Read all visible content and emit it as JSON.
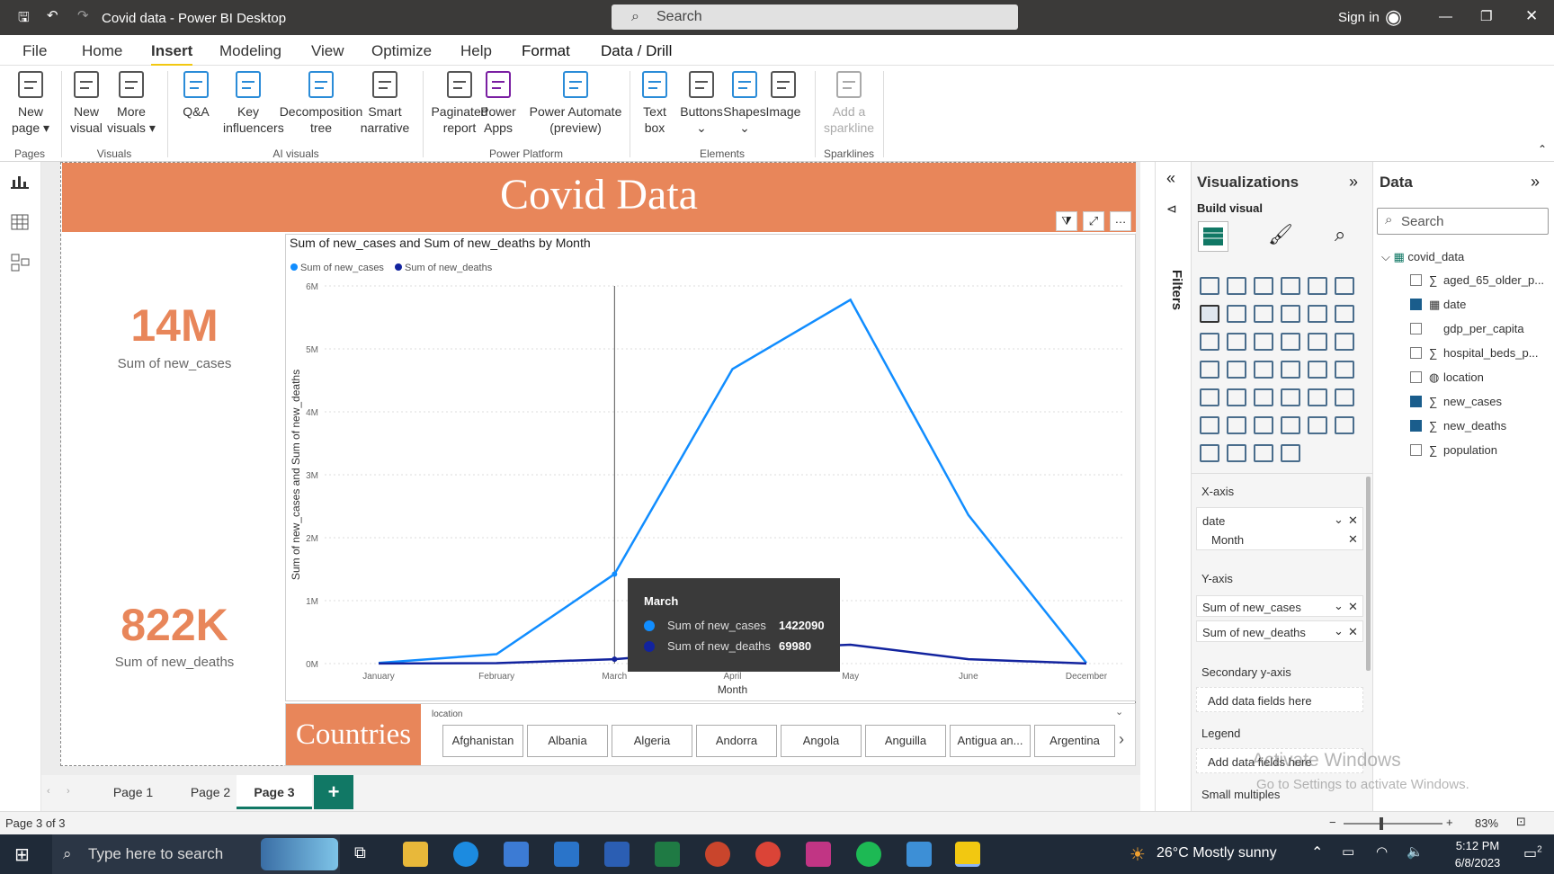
{
  "window": {
    "title": "Covid data - Power BI Desktop",
    "search_placeholder": "Search",
    "sign_in": "Sign in"
  },
  "menu": [
    "File",
    "Home",
    "Insert",
    "Modeling",
    "View",
    "Optimize",
    "Help",
    "Format",
    "Data / Drill"
  ],
  "ribbon": {
    "buttons": [
      {
        "name": "new-page",
        "l1": "New",
        "l2": "page ▾"
      },
      {
        "name": "new-visual",
        "l1": "New",
        "l2": "visual"
      },
      {
        "name": "more-visuals",
        "l1": "More",
        "l2": "visuals ▾"
      },
      {
        "name": "qa",
        "l1": "Q&A",
        "l2": ""
      },
      {
        "name": "key-influencers",
        "l1": "Key",
        "l2": "influencers"
      },
      {
        "name": "decomposition-tree",
        "l1": "Decomposition",
        "l2": "tree"
      },
      {
        "name": "smart-narrative",
        "l1": "Smart",
        "l2": "narrative"
      },
      {
        "name": "paginated-report",
        "l1": "Paginated",
        "l2": "report"
      },
      {
        "name": "power-apps",
        "l1": "Power",
        "l2": "Apps"
      },
      {
        "name": "power-automate",
        "l1": "Power Automate",
        "l2": "(preview)"
      },
      {
        "name": "text-box",
        "l1": "Text",
        "l2": "box"
      },
      {
        "name": "buttons",
        "l1": "Buttons",
        "l2": "⌄"
      },
      {
        "name": "shapes",
        "l1": "Shapes",
        "l2": "⌄"
      },
      {
        "name": "image",
        "l1": "Image",
        "l2": ""
      },
      {
        "name": "add-sparkline",
        "l1": "Add a",
        "l2": "sparkline"
      }
    ],
    "groups": [
      "Pages",
      "Visuals",
      "AI visuals",
      "Power Platform",
      "Elements",
      "Sparklines"
    ]
  },
  "report": {
    "banner_title": "Covid Data",
    "card1": {
      "value": "14M",
      "label": "Sum of new_cases"
    },
    "card2": {
      "value": "822K",
      "label": "Sum of new_deaths"
    },
    "slicer_title": "Countries",
    "slicer_field": "location",
    "countries": [
      "Afghanistan",
      "Albania",
      "Algeria",
      "Andorra",
      "Angola",
      "Anguilla",
      "Antigua an...",
      "Argentina"
    ]
  },
  "chart_data": {
    "type": "line",
    "title": "Sum of new_cases and Sum of new_deaths by Month",
    "xlabel": "Month",
    "ylabel": "Sum of new_cases and Sum of new_deaths",
    "categories": [
      "January",
      "February",
      "March",
      "April",
      "May",
      "June",
      "December"
    ],
    "series": [
      {
        "name": "Sum of new_cases",
        "color": "#118dff",
        "values": [
          10000,
          150000,
          1422090,
          4680000,
          5780000,
          2360000,
          10000
        ]
      },
      {
        "name": "Sum of new_deaths",
        "color": "#12239e",
        "values": [
          1000,
          8000,
          69980,
          220000,
          300000,
          70000,
          1000
        ]
      }
    ],
    "yticks": [
      "0M",
      "1M",
      "2M",
      "3M",
      "4M",
      "5M",
      "6M"
    ],
    "ylim": [
      0,
      6000000
    ],
    "legend": "top-left",
    "grid": true,
    "tooltip": {
      "category": "March",
      "rows": [
        {
          "label": "Sum of new_cases",
          "value": "1422090"
        },
        {
          "label": "Sum of new_deaths",
          "value": "69980"
        }
      ]
    }
  },
  "tabs": [
    "Page 1",
    "Page 2",
    "Page 3"
  ],
  "status": {
    "page": "Page 3 of 3",
    "zoom": "83%"
  },
  "filters_label": "Filters",
  "viz_pane": {
    "title": "Visualizations",
    "build": "Build visual",
    "xaxis": "X-axis",
    "xaxis_f1": "date",
    "xaxis_f2": "Month",
    "yaxis": "Y-axis",
    "yaxis_f1": "Sum of new_cases",
    "yaxis_f2": "Sum of new_deaths",
    "sec_y": "Secondary y-axis",
    "add_here": "Add data fields here",
    "legend": "Legend",
    "small_multiples": "Small multiples"
  },
  "data_pane": {
    "title": "Data",
    "search": "Search",
    "table": "covid_data",
    "fields": [
      {
        "name": "aged_65_older_p...",
        "checked": false,
        "icon": "∑"
      },
      {
        "name": "date",
        "checked": true,
        "icon": "▦"
      },
      {
        "name": "gdp_per_capita",
        "checked": false,
        "icon": ""
      },
      {
        "name": "hospital_beds_p...",
        "checked": false,
        "icon": "∑"
      },
      {
        "name": "location",
        "checked": false,
        "icon": "◍"
      },
      {
        "name": "new_cases",
        "checked": true,
        "icon": "∑"
      },
      {
        "name": "new_deaths",
        "checked": true,
        "icon": "∑"
      },
      {
        "name": "population",
        "checked": false,
        "icon": "∑"
      }
    ]
  },
  "watermark": {
    "l1": "Activate Windows",
    "l2": "Go to Settings to activate Windows."
  },
  "taskbar": {
    "search": "Type here to search",
    "weather": "26°C  Mostly sunny",
    "time": "5:12 PM",
    "date": "6/8/2023",
    "notif": "2"
  }
}
